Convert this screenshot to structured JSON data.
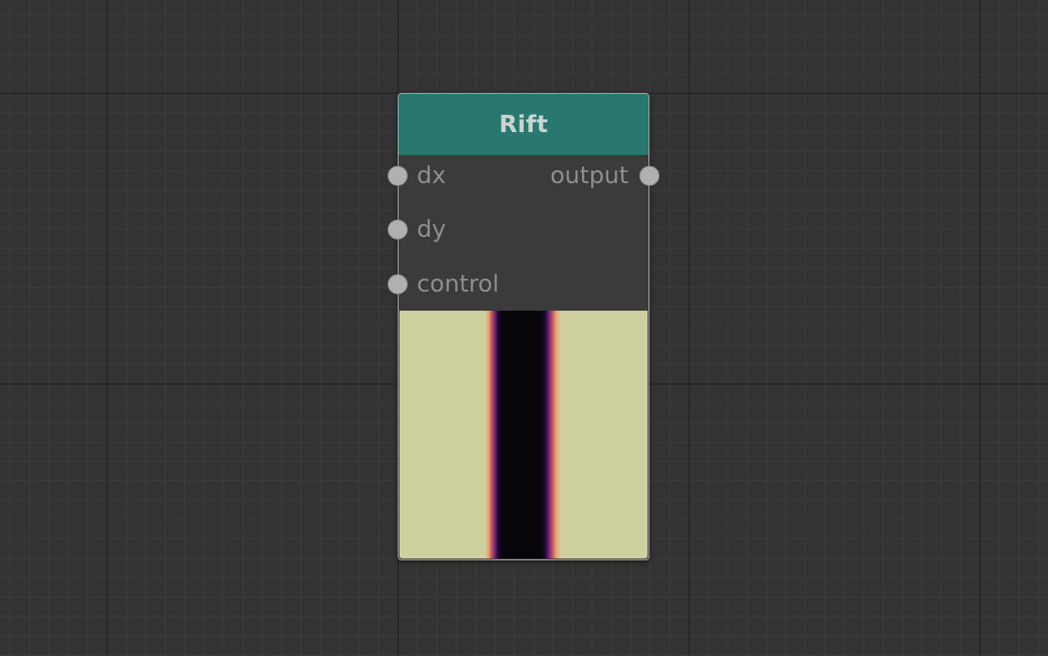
{
  "canvas": {
    "background_color": "#333333",
    "grid_major_color": "#1f1f1f",
    "grid_minor_color": "#3c3c3c"
  },
  "node": {
    "title": "Rift",
    "header_color": "#287870",
    "inputs": [
      {
        "label": "dx"
      },
      {
        "label": "dy"
      },
      {
        "label": "control"
      }
    ],
    "outputs": [
      {
        "label": "output"
      }
    ],
    "preview": {
      "colormap": [
        "#cfd09f",
        "#e8a070",
        "#c85a5a",
        "#7a2a7a",
        "#2a0a40",
        "#06060a"
      ]
    }
  }
}
